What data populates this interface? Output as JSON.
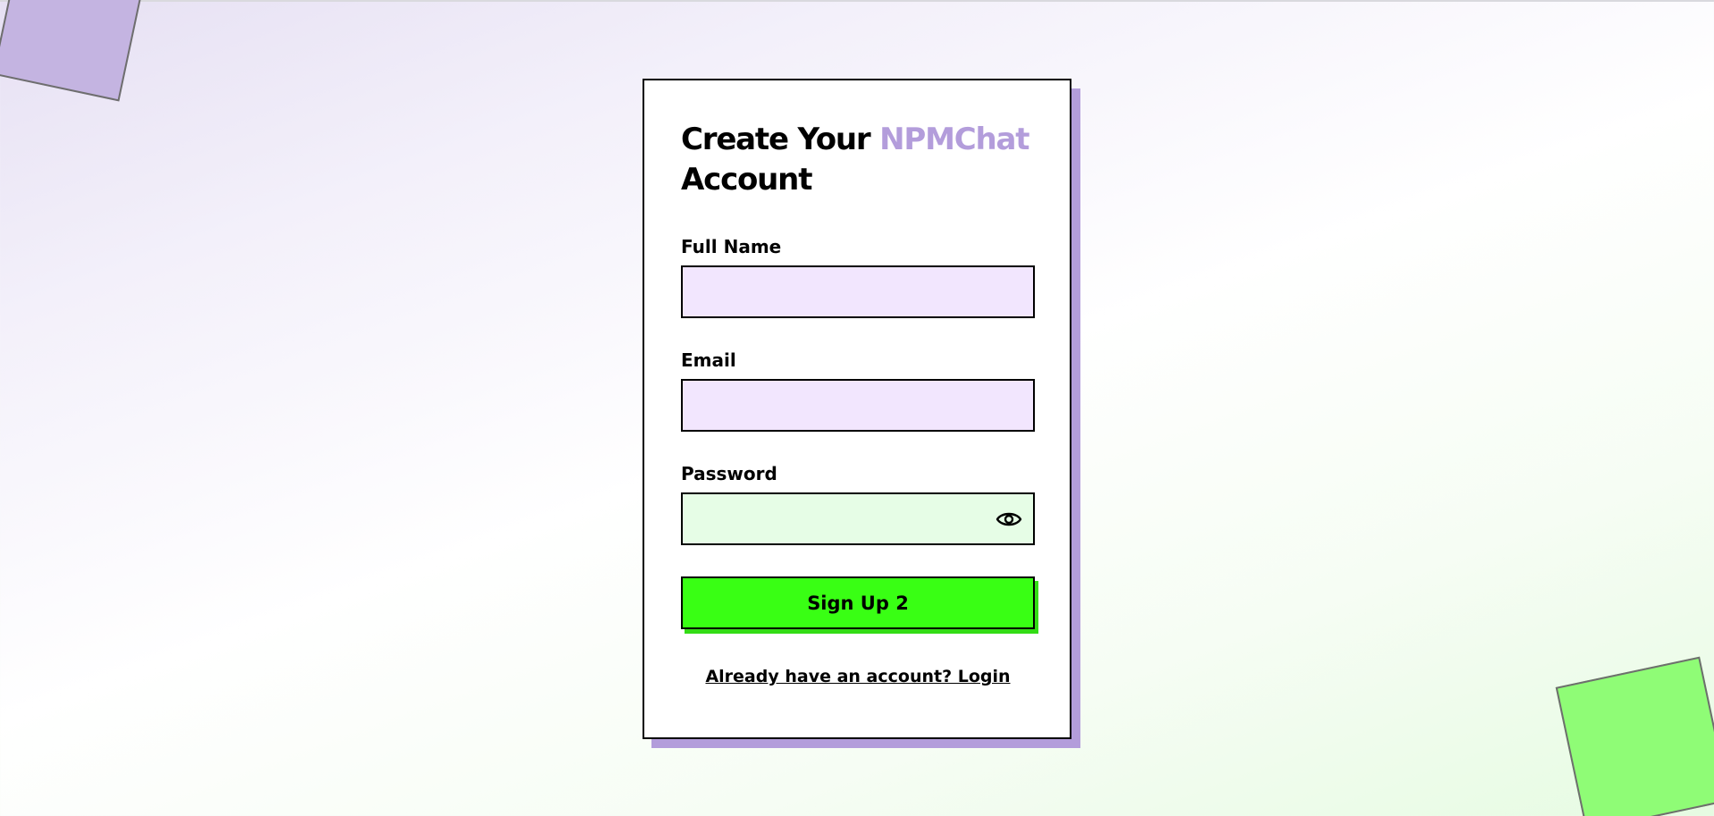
{
  "title": {
    "prefix": "Create Your ",
    "brand": "NPMChat",
    "suffix": "Account"
  },
  "form": {
    "full_name": {
      "label": "Full Name",
      "value": ""
    },
    "email": {
      "label": "Email",
      "value": ""
    },
    "password": {
      "label": "Password",
      "value": ""
    },
    "password_toggle_icon": "eye-icon",
    "submit_label": "Sign Up 2"
  },
  "login_link": "Already have an account? Login",
  "colors": {
    "brand": "#b39ddb",
    "submit": "#39ff14",
    "input_purple": "#f2e6fe",
    "input_green": "#e6fde6",
    "deco_purple": "#c4b4e1",
    "deco_green": "#8ffc76"
  }
}
